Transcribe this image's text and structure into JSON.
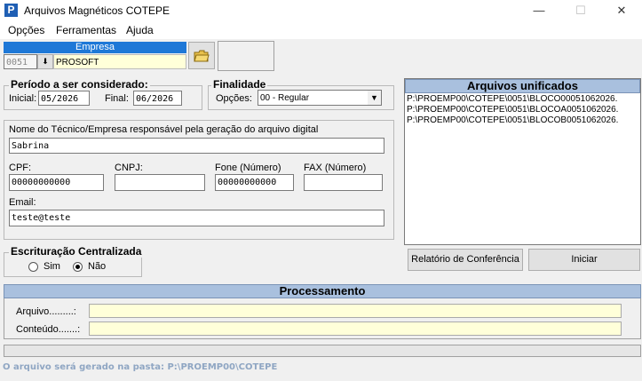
{
  "window": {
    "title": "Arquivos Magnéticos COTEPE",
    "app_icon_letter": "P",
    "minimize": "—",
    "maximize": "☐",
    "close": "✕"
  },
  "menu": {
    "items": [
      "Opções",
      "Ferramentas",
      "Ajuda"
    ]
  },
  "empresa": {
    "header": "Empresa",
    "code": "0051",
    "name": "PROSOFT"
  },
  "periodo": {
    "title": "Período a ser considerado:",
    "initial_label": "Inicial:",
    "initial_value": "05/2026",
    "final_label": "Final:",
    "final_value": "06/2026"
  },
  "finalidade": {
    "title": "Finalidade",
    "options_label": "Opções:",
    "selected": "00 - Regular"
  },
  "tecnico": {
    "name_label": "Nome do Técnico/Empresa responsável pela geração do arquivo digital",
    "name_value": "Sabrina",
    "cpf_label": "CPF:",
    "cpf_value": "00000000000",
    "cnpj_label": "CNPJ:",
    "cnpj_value": "",
    "fone_label": "Fone (Número)",
    "fone_value": "00000000000",
    "fax_label": "FAX (Número)",
    "fax_value": "",
    "email_label": "Email:",
    "email_value": "teste@teste"
  },
  "escrituracao": {
    "title": "Escrituração Centralizada",
    "sim": "Sim",
    "nao": "Não",
    "selected": "nao"
  },
  "unificados": {
    "header": "Arquivos unificados",
    "files": [
      "P:\\PROEMP00\\COTEPE\\0051\\BLOCO00051062026.",
      "P:\\PROEMP00\\COTEPE\\0051\\BLOCOA0051062026.",
      "P:\\PROEMP00\\COTEPE\\0051\\BLOCOB0051062026."
    ]
  },
  "buttons": {
    "relatorio": "Relatório de Conferência",
    "iniciar": "Iniciar"
  },
  "processamento": {
    "header": "Processamento",
    "arquivo_label": "Arquivo.........:",
    "arquivo_value": "",
    "conteudo_label": "Conteúdo.......:",
    "conteudo_value": ""
  },
  "status": {
    "message": "O arquivo será gerado na pasta: P:\\PROEMP00\\COTEPE"
  }
}
